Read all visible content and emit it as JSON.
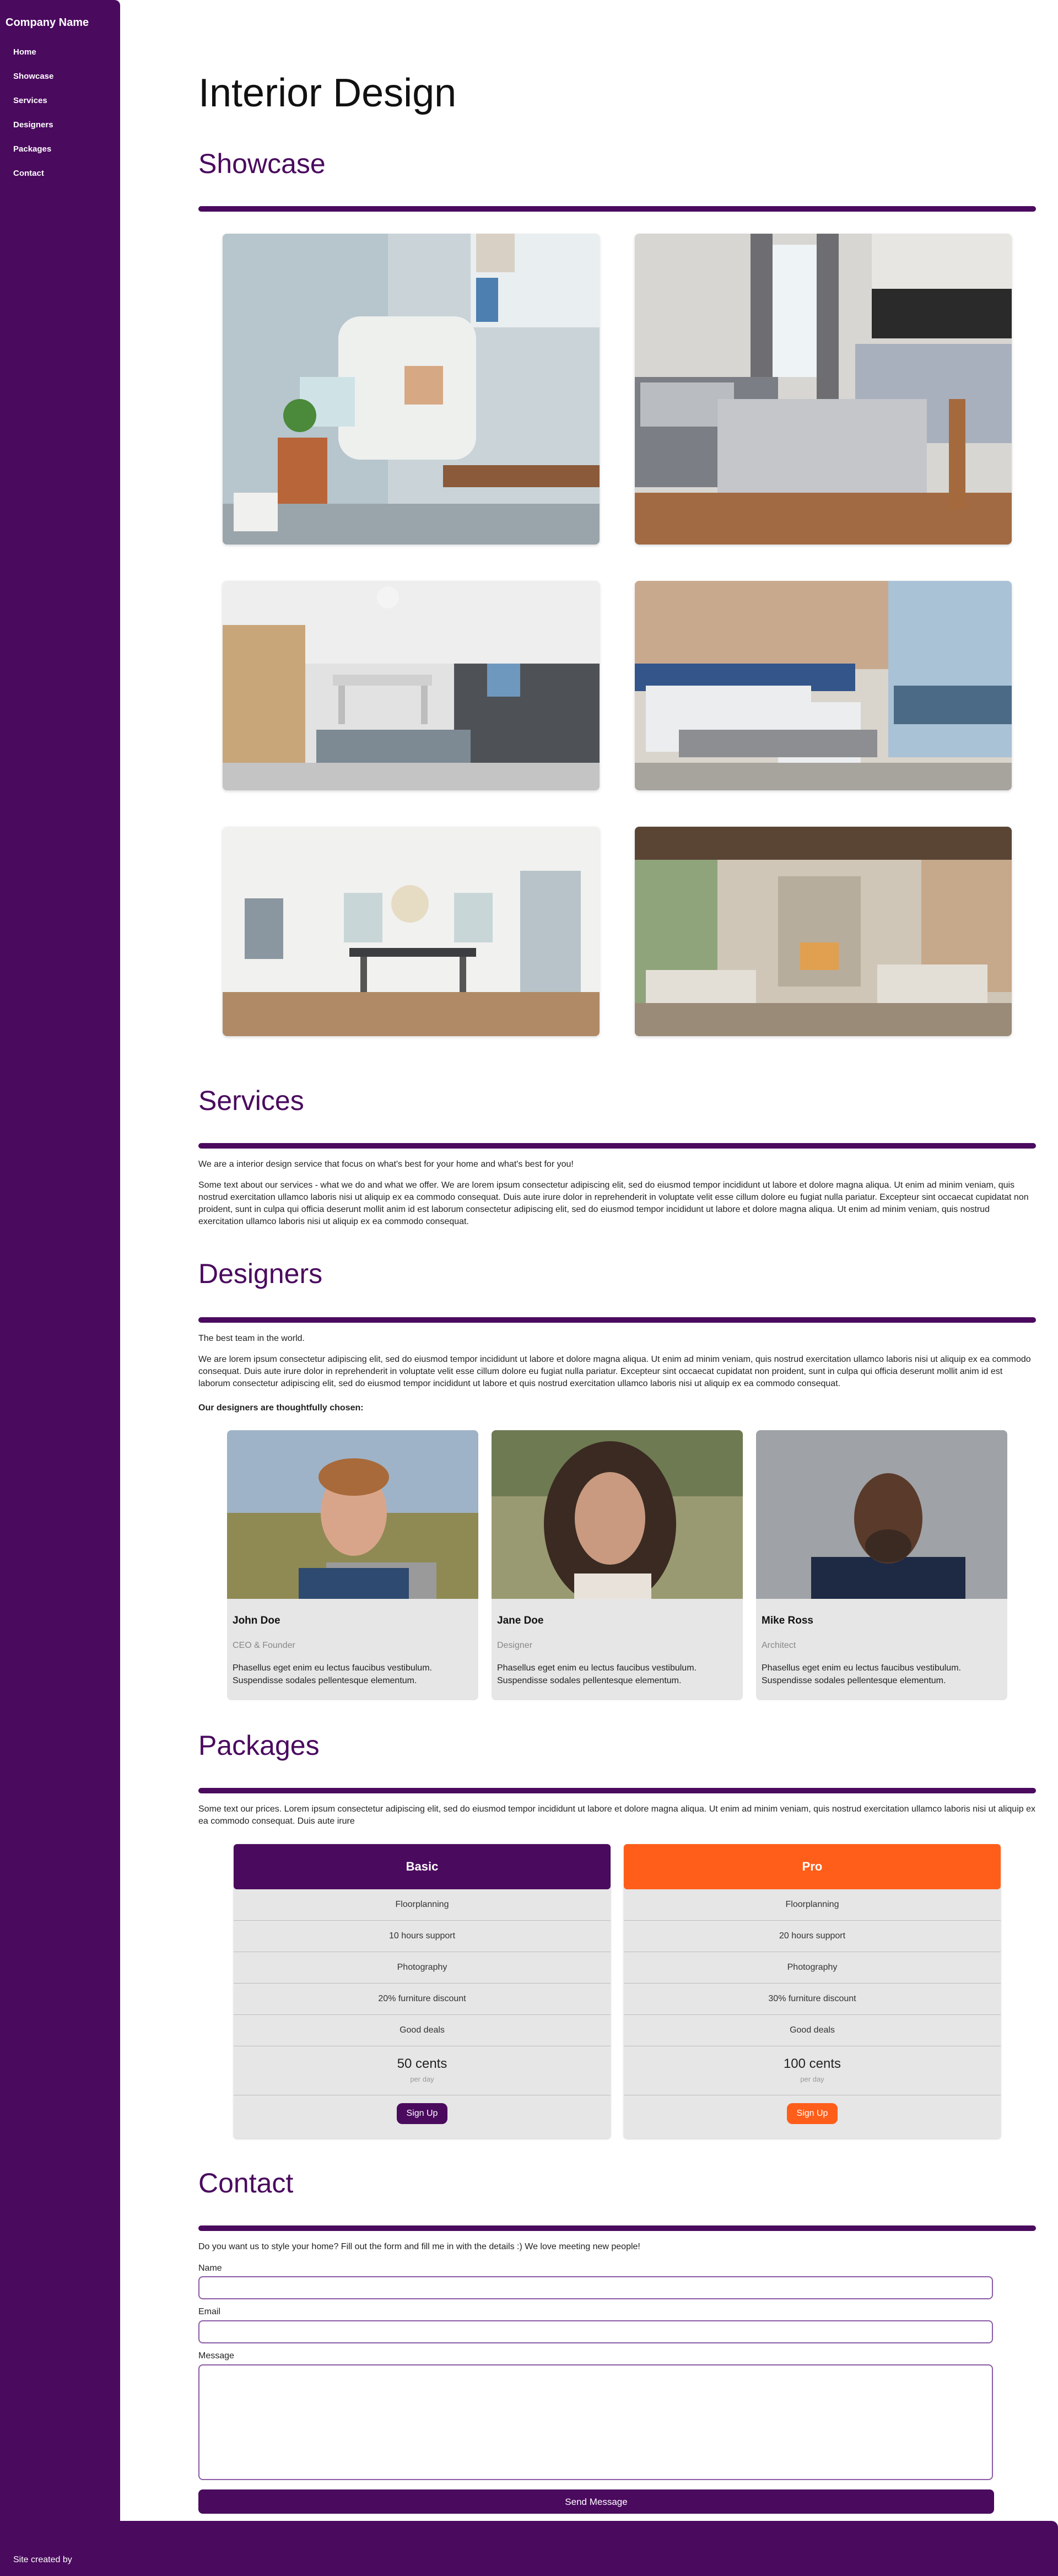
{
  "brand": "Company Name",
  "nav": [
    "Home",
    "Showcase",
    "Services",
    "Designers",
    "Packages",
    "Contact"
  ],
  "page_title": "Interior Design",
  "showcase": {
    "title": "Showcase",
    "images": [
      "living-room-armchair-photo",
      "bedroom-photo",
      "dining-living-room-photo",
      "hotel-bedroom-photo",
      "dining-room-photo",
      "great-room-fireplace-photo"
    ]
  },
  "services": {
    "title": "Services",
    "intro": "We are a interior design service that focus on what's best for your home and what's best for you!",
    "body": "Some text about our services - what we do and what we offer. We are lorem ipsum consectetur adipiscing elit, sed do eiusmod tempor incididunt ut labore et dolore magna aliqua. Ut enim ad minim veniam, quis nostrud exercitation ullamco laboris nisi ut aliquip ex ea commodo consequat. Duis aute irure dolor in reprehenderit in voluptate velit esse cillum dolore eu fugiat nulla pariatur. Excepteur sint occaecat cupidatat non proident, sunt in culpa qui officia deserunt mollit anim id est laborum consectetur adipiscing elit, sed do eiusmod tempor incididunt ut labore et dolore magna aliqua. Ut enim ad minim veniam, quis nostrud exercitation ullamco laboris nisi ut aliquip ex ea commodo consequat."
  },
  "designers": {
    "title": "Designers",
    "intro": "The best team in the world.",
    "body": "We are lorem ipsum consectetur adipiscing elit, sed do eiusmod tempor incididunt ut labore et dolore magna aliqua. Ut enim ad minim veniam, quis nostrud exercitation ullamco laboris nisi ut aliquip ex ea commodo consequat. Duis aute irure dolor in reprehenderit in voluptate velit esse cillum dolore eu fugiat nulla pariatur. Excepteur sint occaecat cupidatat non proident, sunt in culpa qui officia deserunt mollit anim id est laborum consectetur adipiscing elit, sed do eiusmod tempor incididunt ut labore et quis nostrud exercitation ullamco laboris nisi ut aliquip ex ea commodo consequat.",
    "chosen": "Our designers are thoughtfully chosen:",
    "people": [
      {
        "name": "John Doe",
        "role": "CEO & Founder",
        "desc": "Phasellus eget enim eu lectus faucibus vestibulum. Suspendisse sodales pellentesque elementum."
      },
      {
        "name": "Jane Doe",
        "role": "Designer",
        "desc": "Phasellus eget enim eu lectus faucibus vestibulum. Suspendisse sodales pellentesque elementum."
      },
      {
        "name": "Mike Ross",
        "role": "Architect",
        "desc": "Phasellus eget enim eu lectus faucibus vestibulum. Suspendisse sodales pellentesque elementum."
      }
    ]
  },
  "packages": {
    "title": "Packages",
    "intro": "Some text our prices. Lorem ipsum consectetur adipiscing elit, sed do eiusmod tempor incididunt ut labore et dolore magna aliqua. Ut enim ad minim veniam, quis nostrud exercitation ullamco laboris nisi ut aliquip ex ea commodo consequat. Duis aute irure",
    "plans": [
      {
        "name": "Basic",
        "color": "#4a0a5e",
        "features": [
          "Floorplanning",
          "10 hours support",
          "Photography",
          "20% furniture discount",
          "Good deals"
        ],
        "price": "50 cents",
        "period": "per day",
        "button": "Sign Up"
      },
      {
        "name": "Pro",
        "color": "#ff5e1a",
        "features": [
          "Floorplanning",
          "20 hours support",
          "Photography",
          "30% furniture discount",
          "Good deals"
        ],
        "price": "100 cents",
        "period": "per day",
        "button": "Sign Up"
      }
    ]
  },
  "contact": {
    "title": "Contact",
    "intro": "Do you want us to style your home? Fill out the form and fill me in with the details :) We love meeting new people!",
    "name_label": "Name",
    "email_label": "Email",
    "message_label": "Message",
    "name_value": "",
    "email_value": "",
    "message_value": "",
    "send": "Send Message"
  },
  "footer": "Site created by",
  "colors": {
    "primary": "#4a0a5e",
    "accent": "#ff5e1a",
    "card": "#e6e6e6"
  }
}
